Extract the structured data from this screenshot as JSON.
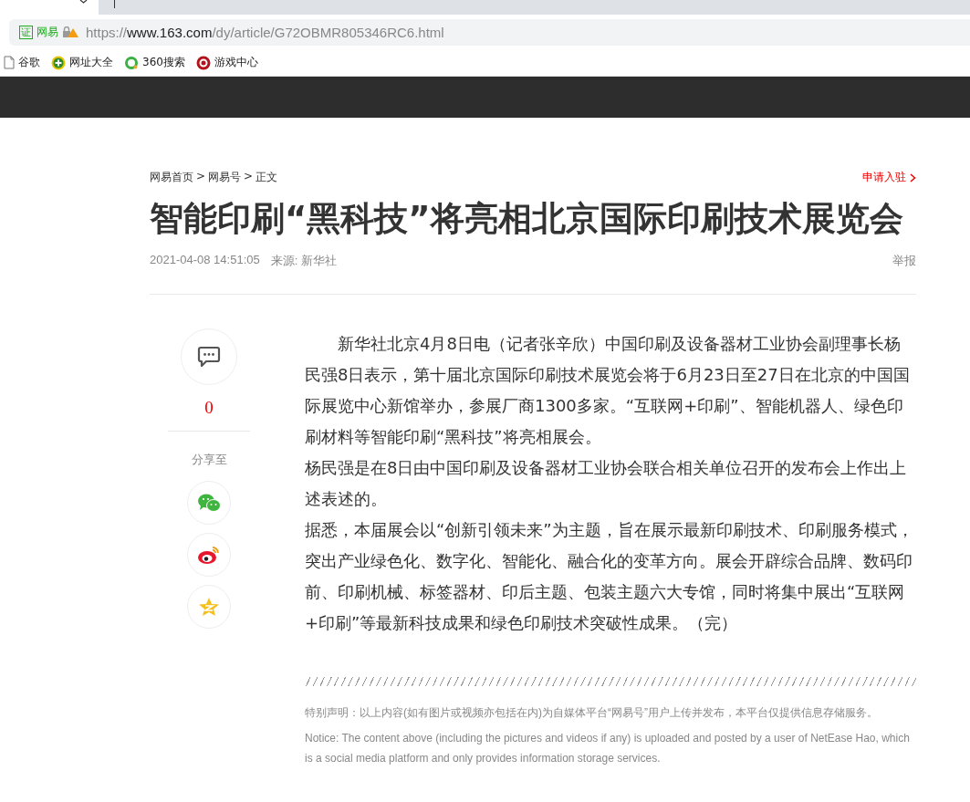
{
  "browser": {
    "address": {
      "cert_label": "证",
      "site_label": "网易",
      "url_prefix": "https://",
      "url_host": "www.163.com",
      "url_path": "/dy/article/G72OBMR805346RC6.html"
    },
    "bookmarks": [
      {
        "kind": "page",
        "label": "谷歌"
      },
      {
        "kind": "plus",
        "label": "网址大全"
      },
      {
        "kind": "ring",
        "label": "360搜索"
      },
      {
        "kind": "game",
        "label": "游戏中心"
      }
    ]
  },
  "breadcrumb": [
    "网易首页",
    "网易号",
    "正文"
  ],
  "breadcrumb_separator": ">",
  "apply_link": "申请入驻",
  "title": "智能印刷“黑科技”将亮相北京国际印刷技术展览会",
  "meta": {
    "time": "2021-04-08 14:51:05",
    "source": "来源: 新华社",
    "report": "举报"
  },
  "sidebar": {
    "comment_count": "0",
    "share_label": "分享至",
    "share": [
      {
        "kind": "wechat"
      },
      {
        "kind": "weibo"
      },
      {
        "kind": "qzone"
      }
    ]
  },
  "paragraphs": [
    {
      "text": "新华社北京4月8日电（记者张辛欣）中国印刷及设备器材工业协会副理事长杨民强8日表示，第十届北京国际印刷技术展览会将于6月23日至27日在北京的中国国际展览中心新馆举办，参展厂商1300多家。“互联网+印刷”、智能机器人、绿色印刷材料等智能印刷“黑科技”将亮相展会。",
      "indent": true
    },
    {
      "text": "杨民强是在8日由中国印刷及设备器材工业协会联合相关单位召开的发布会上作出上述表述的。",
      "indent": false
    },
    {
      "text": "据悉，本届展会以“创新引领未来”为主题，旨在展示最新印刷技术、印刷服务模式，突出产业绿色化、数字化、智能化、融合化的变革方向。展会开辟综合品牌、数码印前、印刷机械、标签器材、印后主题、包装主题六大专馆，同时将集中展出“互联网+印刷”等最新科技成果和绿色印刷技术突破性成果。（完）",
      "indent": false
    }
  ],
  "statement_cn": "特别声明：以上内容(如有图片或视频亦包括在内)为自媒体平台“网易号”用户上传并发布，本平台仅提供信息存储服务。",
  "statement_en": "Notice: The content above (including the pictures and videos if any) is uploaded and posted by a user of NetEase Hao, which is a social media platform and only provides information storage services."
}
